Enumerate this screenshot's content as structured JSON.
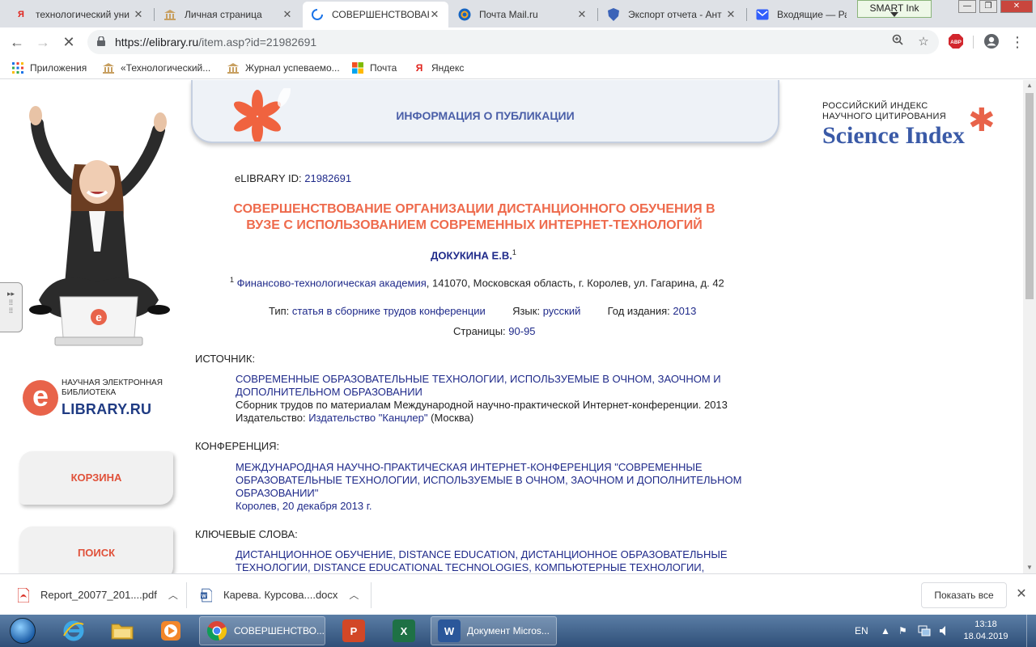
{
  "browser": {
    "tabs": [
      {
        "title": "технологический уни",
        "favicon": "yandex-icon"
      },
      {
        "title": "Личная страница",
        "favicon": "university-icon"
      },
      {
        "title": "СОВЕРШЕНСТВОВАН",
        "favicon": "loading-icon",
        "active": true
      },
      {
        "title": "Почта Mail.ru",
        "favicon": "mailru-icon"
      },
      {
        "title": "Экспорт отчета - Ант",
        "favicon": "antiplagiat-icon"
      },
      {
        "title": "Входящие — Рамбл",
        "favicon": "rambler-mail-icon"
      }
    ],
    "smart_ink": "SMART Ink",
    "url_host": "https://elibrary.ru",
    "url_path": "/item.asp?id=21982691",
    "abp_label": "ABP",
    "bookmarks": [
      {
        "label": "Приложения",
        "icon": "apps-grid-icon"
      },
      {
        "label": "«Технологический...",
        "icon": "university-icon"
      },
      {
        "label": "Журнал успеваемо...",
        "icon": "university-icon"
      },
      {
        "label": "Почта",
        "icon": "microsoft-icon"
      },
      {
        "label": "Яндекс",
        "icon": "yandex-icon"
      }
    ]
  },
  "page": {
    "banner_title": "ИНФОРМАЦИЯ О ПУБЛИКАЦИИ",
    "science_index": {
      "line1": "РОССИЙСКИЙ ИНДЕКС",
      "line2": "НАУЧНОГО ЦИТИРОВАНИЯ",
      "brand": "Science Index"
    },
    "elibrary_logo": {
      "letter": "e",
      "caption1": "НАУЧНАЯ ЭЛЕКТРОННАЯ",
      "caption2": "БИБЛИОТЕКА",
      "word": "LIBRARY.RU"
    },
    "laptop_letter": "e",
    "side_buttons": {
      "cart": "КОРЗИНА",
      "search": "ПОИСК"
    },
    "elib_id_label": "eLIBRARY ID:",
    "elib_id_value": "21982691",
    "title_line1": "СОВЕРШЕНСТВОВАНИЕ ОРГАНИЗАЦИИ ДИСТАНЦИОННОГО ОБУЧЕНИЯ В",
    "title_line2": "ВУЗЕ С ИСПОЛЬЗОВАНИЕМ СОВРЕМЕННЫХ ИНТЕРНЕТ-ТЕХНОЛОГИЙ",
    "author": "ДОКУКИНА Е.В.",
    "author_sup": "1",
    "affiliation_sup": "1",
    "affiliation_org": "Финансово-технологическая академия",
    "affiliation_rest": ", 141070, Московская область, г. Королев, ул. Гагарина, д. 42",
    "type_label": "Тип:",
    "type_value": "статья в сборнике трудов конференции",
    "lang_label": "Язык:",
    "lang_value": "русский",
    "year_label": "Год издания:",
    "year_value": "2013",
    "pages_label": "Страницы:",
    "pages_value": "90-95",
    "source_heading": "ИСТОЧНИК:",
    "source_title_1": "СОВРЕМЕННЫЕ ОБРАЗОВАТЕЛЬНЫЕ ТЕХНОЛОГИИ, ИСПОЛЬЗУЕМЫЕ В ОЧНОМ, ЗАОЧНОМ И",
    "source_title_2": "ДОПОЛНИТЕЛЬНОМ ОБРАЗОВАНИИ",
    "source_desc": "Сборник трудов по материалам Международной научно-практической Интернет-конференции. 2013",
    "publisher_label": "Издательство:",
    "publisher_value": "Издательство \"Канцлер\"",
    "publisher_city": "(Москва)",
    "conf_heading": "КОНФЕРЕНЦИЯ:",
    "conf_title_1": "МЕЖДУНАРОДНАЯ НАУЧНО-ПРАКТИЧЕСКАЯ ИНТЕРНЕТ-КОНФЕРЕНЦИЯ \"СОВРЕМЕННЫЕ",
    "conf_title_2": "ОБРАЗОВАТЕЛЬНЫЕ ТЕХНОЛОГИИ, ИСПОЛЬЗУЕМЫЕ В ОЧНОМ, ЗАОЧНОМ И ДОПОЛНИТЕЛЬНОМ",
    "conf_title_3": "ОБРАЗОВАНИИ\"",
    "conf_place": "Королев, 20 декабря 2013 г.",
    "kw_heading": "КЛЮЧЕВЫЕ СЛОВА:",
    "kw_line1": "ДИСТАНЦИОННОЕ ОБУЧЕНИЕ, DISTANCE EDUCATION, ДИСТАНЦИОННОЕ ОБРАЗОВАТЕЛЬНЫЕ",
    "kw_line2": "ТЕХНОЛОГИИ, DISTANCE EDUCATIONAL TECHNOLOGIES, КОМПЬЮТЕРНЫЕ ТЕХНОЛОГИИ, COMPUTER"
  },
  "downloads": {
    "items": [
      {
        "name": "Report_20077_201....pdf",
        "icon": "pdf-file-icon"
      },
      {
        "name": "Карева. Курсова....docx",
        "icon": "word-file-icon"
      }
    ],
    "show_all": "Показать все"
  },
  "taskbar": {
    "chrome_label": "СОВЕРШЕНСТВО...",
    "word_label": "Документ Micros...",
    "lang": "EN",
    "time": "13:18",
    "date": "18.04.2019"
  },
  "colors": {
    "accent_orange": "#ee6a4c",
    "link_blue": "#1f2a8a",
    "banner_blue": "#4a5fa8"
  }
}
